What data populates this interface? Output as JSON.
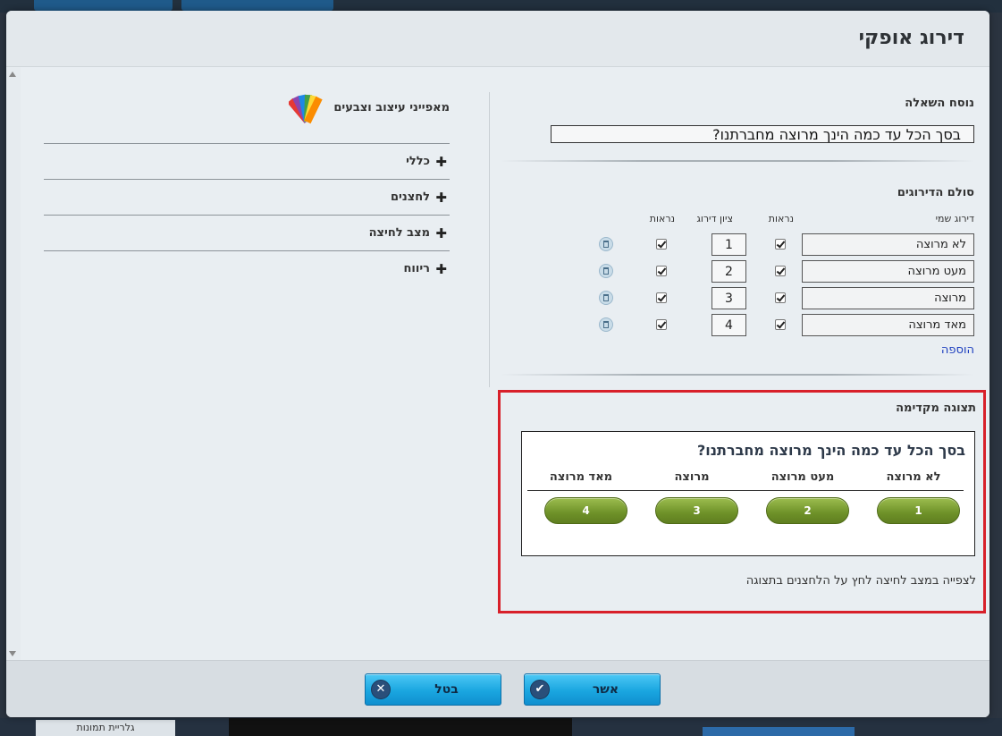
{
  "background": {
    "gallery_label": "גלריית תמונות"
  },
  "modal": {
    "title": "דירוג אופקי"
  },
  "question": {
    "label": "נוסח השאלה",
    "value": "בסך הכל עד כמה הינך מרוצה מחברתנו?"
  },
  "scale": {
    "label": "סולם הדירוגים",
    "headers": {
      "name": "דירוג שמי",
      "visible_name": "נראות",
      "score": "ציון דירוג",
      "visible_score": "נראות"
    },
    "rows": [
      {
        "name": "לא מרוצה",
        "score": "1"
      },
      {
        "name": "מעט מרוצה",
        "score": "2"
      },
      {
        "name": "מרוצה",
        "score": "3"
      },
      {
        "name": "מאד מרוצה",
        "score": "4"
      }
    ],
    "add_label": "הוספה"
  },
  "preview": {
    "label": "תצוגה מקדימה",
    "question": "בסך הכל עד כמה הינך מרוצה מחברתנו?",
    "columns": [
      "לא מרוצה",
      "מעט מרוצה",
      "מרוצה",
      "מאד מרוצה"
    ],
    "buttons": [
      "1",
      "2",
      "3",
      "4"
    ],
    "note": "לצפייה במצב לחיצה לחץ על הלחצנים בתצוגה"
  },
  "design": {
    "title": "מאפייני עיצוב וצבעים",
    "sections": [
      "כללי",
      "לחצנים",
      "מצב לחיצה",
      "ריווח"
    ]
  },
  "footer": {
    "confirm_label": "אשר",
    "cancel_label": "בטל"
  },
  "colors": {
    "accent_button": "#1aa6e0",
    "preview_button": "#6e9128",
    "highlight_border": "#d8202a"
  }
}
